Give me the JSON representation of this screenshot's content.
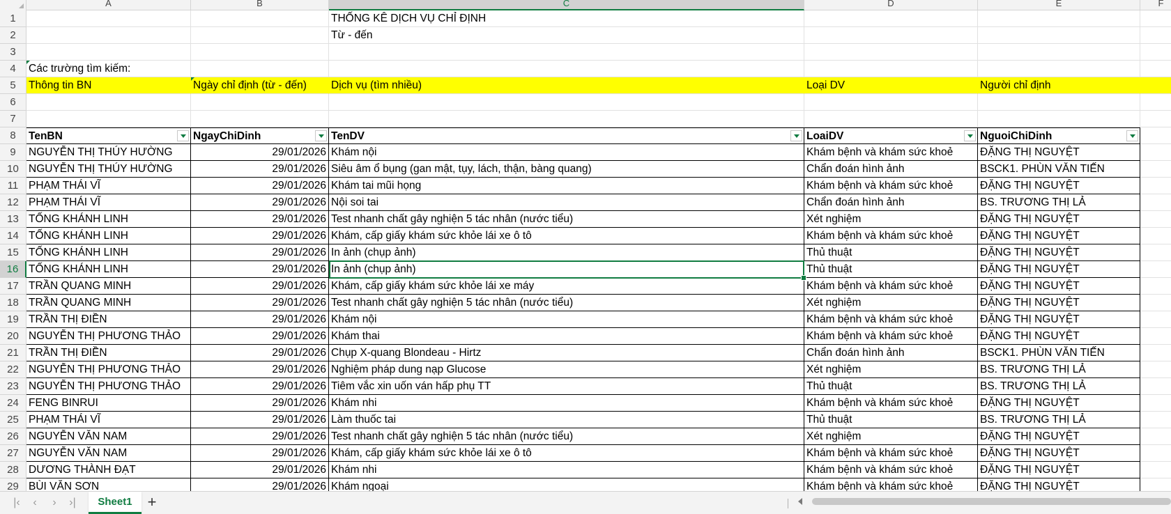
{
  "columns": [
    "A",
    "B",
    "C",
    "D",
    "E",
    "F"
  ],
  "active_column": "C",
  "active_row": "16",
  "rows": [
    {
      "n": "1",
      "type": "text",
      "cells": {
        "C": "THỐNG KÊ DỊCH VỤ CHỈ ĐỊNH"
      }
    },
    {
      "n": "2",
      "type": "text",
      "cells": {
        "C": "Từ - đến"
      }
    },
    {
      "n": "3",
      "type": "text",
      "cells": {}
    },
    {
      "n": "4",
      "type": "text",
      "cells": {
        "A": "Các trường tìm kiếm:"
      }
    },
    {
      "n": "5",
      "type": "yellow",
      "cells": {
        "A": "Thông tin BN",
        "B": "Ngày chỉ định (từ - đến)",
        "C": "Dịch vụ (tìm nhiều)",
        "D": "Loại DV",
        "E": "Người chỉ định"
      }
    },
    {
      "n": "6",
      "type": "text",
      "cells": {}
    },
    {
      "n": "7",
      "type": "text",
      "cells": {}
    },
    {
      "n": "8",
      "type": "header",
      "cells": {
        "A": "TenBN",
        "B": "NgayChiDinh",
        "C": "TenDV",
        "D": "LoaiDV",
        "E": "NguoiChiDinh"
      }
    },
    {
      "n": "9",
      "type": "data",
      "cells": {
        "A": "NGUYỄN THỊ THÚY HƯỜNG",
        "B": "29/01/2026",
        "C": "Khám nội",
        "D": "Khám bệnh và khám sức khoẻ",
        "E": "ĐẶNG THỊ NGUYỆT"
      }
    },
    {
      "n": "10",
      "type": "data",
      "cells": {
        "A": "NGUYỄN THỊ THÚY HƯỜNG",
        "B": "29/01/2026",
        "C": "Siêu âm ổ bụng (gan mật, tụy, lách, thận, bàng quang)",
        "D": "Chẩn đoán hình ảnh",
        "E": "BSCK1. PHÙN VĂN TIẾN"
      }
    },
    {
      "n": "11",
      "type": "data",
      "cells": {
        "A": "PHẠM THÁI VĨ",
        "B": "29/01/2026",
        "C": "Khám tai mũi họng",
        "D": "Khám bệnh và khám sức khoẻ",
        "E": "ĐẶNG THỊ NGUYỆT"
      }
    },
    {
      "n": "12",
      "type": "data",
      "cells": {
        "A": "PHẠM THÁI VĨ",
        "B": "29/01/2026",
        "C": "Nội soi tai",
        "D": "Chẩn đoán hình ảnh",
        "E": "BS. TRƯƠNG THỊ LẢ"
      }
    },
    {
      "n": "13",
      "type": "data",
      "cells": {
        "A": "TỐNG KHÁNH LINH",
        "B": "29/01/2026",
        "C": "Test nhanh chất gây nghiện 5 tác nhân (nước tiểu)",
        "D": "Xét nghiệm",
        "E": "ĐẶNG THỊ NGUYỆT"
      }
    },
    {
      "n": "14",
      "type": "data",
      "cells": {
        "A": "TỐNG KHÁNH LINH",
        "B": "29/01/2026",
        "C": "Khám, cấp giấy khám sức khỏe lái xe ô tô",
        "D": "Khám bệnh và khám sức khoẻ",
        "E": "ĐẶNG THỊ NGUYỆT"
      }
    },
    {
      "n": "15",
      "type": "data",
      "cells": {
        "A": "TỐNG KHÁNH LINH",
        "B": "29/01/2026",
        "C": "In ảnh (chụp ảnh)",
        "D": "Thủ thuật",
        "E": "ĐẶNG THỊ NGUYỆT"
      }
    },
    {
      "n": "16",
      "type": "data",
      "cells": {
        "A": "TỐNG KHÁNH LINH",
        "B": "29/01/2026",
        "C": "In ảnh (chụp ảnh)",
        "D": "Thủ thuật",
        "E": "ĐẶNG THỊ NGUYỆT"
      }
    },
    {
      "n": "17",
      "type": "data",
      "cells": {
        "A": "TRẦN QUANG MINH",
        "B": "29/01/2026",
        "C": "Khám, cấp giấy khám sức khỏe lái xe máy",
        "D": "Khám bệnh và khám sức khoẻ",
        "E": "ĐẶNG THỊ NGUYỆT"
      }
    },
    {
      "n": "18",
      "type": "data",
      "cells": {
        "A": "TRẦN QUANG MINH",
        "B": "29/01/2026",
        "C": "Test nhanh chất gây nghiện 5 tác nhân (nước tiểu)",
        "D": "Xét nghiệm",
        "E": "ĐẶNG THỊ NGUYỆT"
      }
    },
    {
      "n": "19",
      "type": "data",
      "cells": {
        "A": "TRẦN THỊ ĐIỀN",
        "B": "29/01/2026",
        "C": "Khám nội",
        "D": "Khám bệnh và khám sức khoẻ",
        "E": "ĐẶNG THỊ NGUYỆT"
      }
    },
    {
      "n": "20",
      "type": "data",
      "cells": {
        "A": "NGUYỄN THỊ PHƯƠNG THẢO",
        "B": "29/01/2026",
        "C": "Khám thai",
        "D": "Khám bệnh và khám sức khoẻ",
        "E": "ĐẶNG THỊ NGUYỆT"
      }
    },
    {
      "n": "21",
      "type": "data",
      "cells": {
        "A": "TRẦN THỊ ĐIỀN",
        "B": "29/01/2026",
        "C": "Chụp X-quang Blondeau - Hirtz",
        "D": "Chẩn đoán hình ảnh",
        "E": "BSCK1. PHÙN VĂN TIẾN"
      }
    },
    {
      "n": "22",
      "type": "data",
      "cells": {
        "A": "NGUYỄN THỊ PHƯƠNG THẢO",
        "B": "29/01/2026",
        "C": "Nghiệm pháp dung nạp Glucose",
        "D": "Xét nghiệm",
        "E": "BS. TRƯƠNG THỊ LẢ"
      }
    },
    {
      "n": "23",
      "type": "data",
      "cells": {
        "A": "NGUYỄN THỊ PHƯƠNG THẢO",
        "B": "29/01/2026",
        "C": "Tiêm vắc xin uốn ván hấp phụ TT",
        "D": "Thủ thuật",
        "E": "BS. TRƯƠNG THỊ LẢ"
      }
    },
    {
      "n": "24",
      "type": "data",
      "cells": {
        "A": "FENG BINRUI",
        "B": "29/01/2026",
        "C": "Khám nhi",
        "D": "Khám bệnh và khám sức khoẻ",
        "E": "ĐẶNG THỊ NGUYỆT"
      }
    },
    {
      "n": "25",
      "type": "data",
      "cells": {
        "A": "PHẠM THÁI VĨ",
        "B": "29/01/2026",
        "C": "Làm thuốc tai",
        "D": "Thủ thuật",
        "E": "BS. TRƯƠNG THỊ LẢ"
      }
    },
    {
      "n": "26",
      "type": "data",
      "cells": {
        "A": "NGUYỄN VĂN NAM",
        "B": "29/01/2026",
        "C": "Test nhanh chất gây nghiện 5 tác nhân (nước tiểu)",
        "D": "Xét nghiệm",
        "E": "ĐẶNG THỊ NGUYỆT"
      }
    },
    {
      "n": "27",
      "type": "data",
      "cells": {
        "A": "NGUYỄN VĂN NAM",
        "B": "29/01/2026",
        "C": "Khám, cấp giấy khám sức khỏe lái xe ô tô",
        "D": "Khám bệnh và khám sức khoẻ",
        "E": "ĐẶNG THỊ NGUYỆT"
      }
    },
    {
      "n": "28",
      "type": "data",
      "cells": {
        "A": "DƯƠNG THÀNH ĐẠT",
        "B": "29/01/2026",
        "C": "Khám nhi",
        "D": "Khám bệnh và khám sức khoẻ",
        "E": "ĐẶNG THỊ NGUYỆT"
      }
    },
    {
      "n": "29",
      "type": "data",
      "cells": {
        "A": "BÙI VĂN SƠN",
        "B": "29/01/2026",
        "C": "Khám ngoại",
        "D": "Khám bệnh và khám sức khoẻ",
        "E": "ĐẶNG THỊ NGUYỆT"
      }
    }
  ],
  "footer": {
    "sheet_tab": "Sheet1",
    "add_sheet": "+",
    "nav_icons": [
      "first-sheet-icon",
      "prev-sheet-icon",
      "next-sheet-icon",
      "last-sheet-icon"
    ]
  },
  "colors": {
    "accent": "#107c41",
    "highlight": "#ffff00"
  }
}
